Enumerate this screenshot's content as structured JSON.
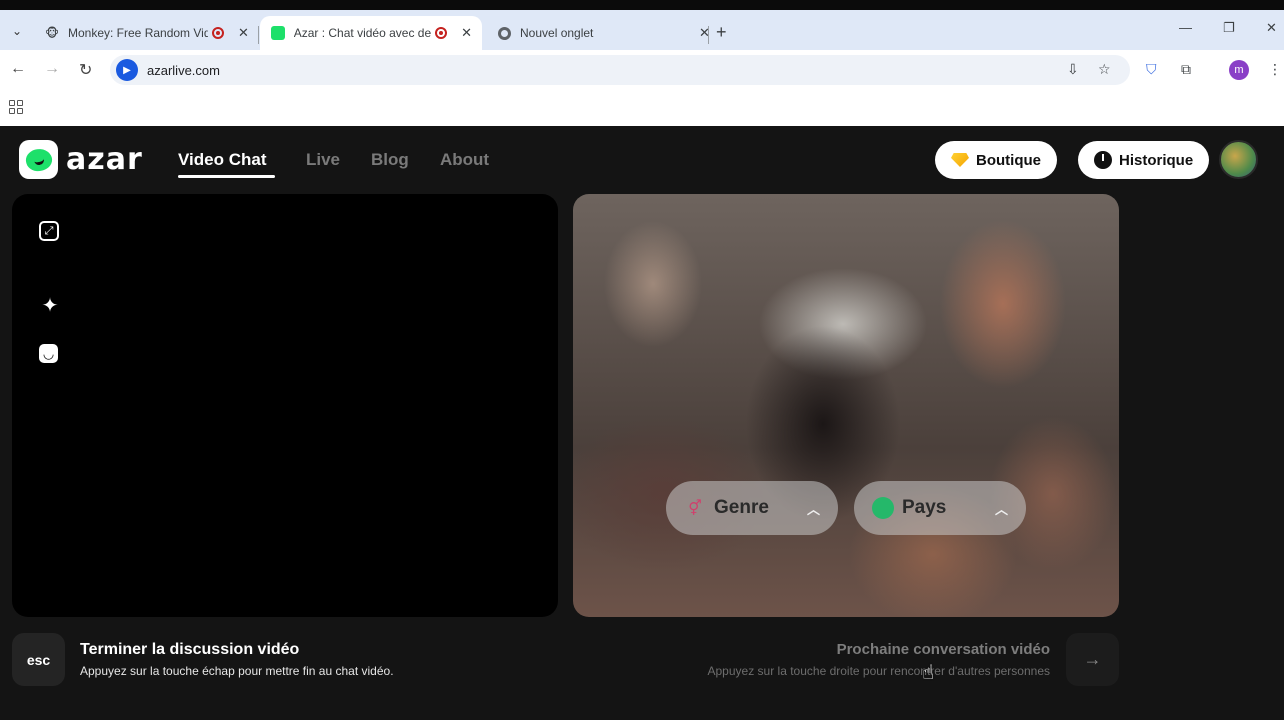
{
  "browser": {
    "tabs": [
      {
        "title": "Monkey: Free Random Vide",
        "favicon": "🐵",
        "recording": true,
        "active": false
      },
      {
        "title": "Azar : Chat vidéo avec de n",
        "favicon": "azar-favicon",
        "recording": true,
        "active": true
      },
      {
        "title": "Nouvel onglet",
        "favicon": "chrome-icon",
        "recording": false,
        "active": false
      }
    ],
    "url": "azarlive.com",
    "profile_initial": "m"
  },
  "site": {
    "logo_text": "azar",
    "nav": [
      {
        "label": "Video Chat",
        "active": true
      },
      {
        "label": "Live",
        "active": false
      },
      {
        "label": "Blog",
        "active": false
      },
      {
        "label": "About",
        "active": false
      }
    ],
    "shop_label": "Boutique",
    "history_label": "Historique"
  },
  "filters": {
    "gender_label": "Genre",
    "country_label": "Pays"
  },
  "footer": {
    "esc_key": "esc",
    "end_title": "Terminer la discussion vidéo",
    "end_subtitle": "Appuyez sur la touche échap pour mettre fin au chat vidéo.",
    "next_title": "Prochaine conversation vidéo",
    "next_subtitle": "Appuyez sur la touche droite pour rencontrer d'autres personnes"
  },
  "colors": {
    "brand_green": "#1de06a",
    "page_bg": "#141414"
  }
}
